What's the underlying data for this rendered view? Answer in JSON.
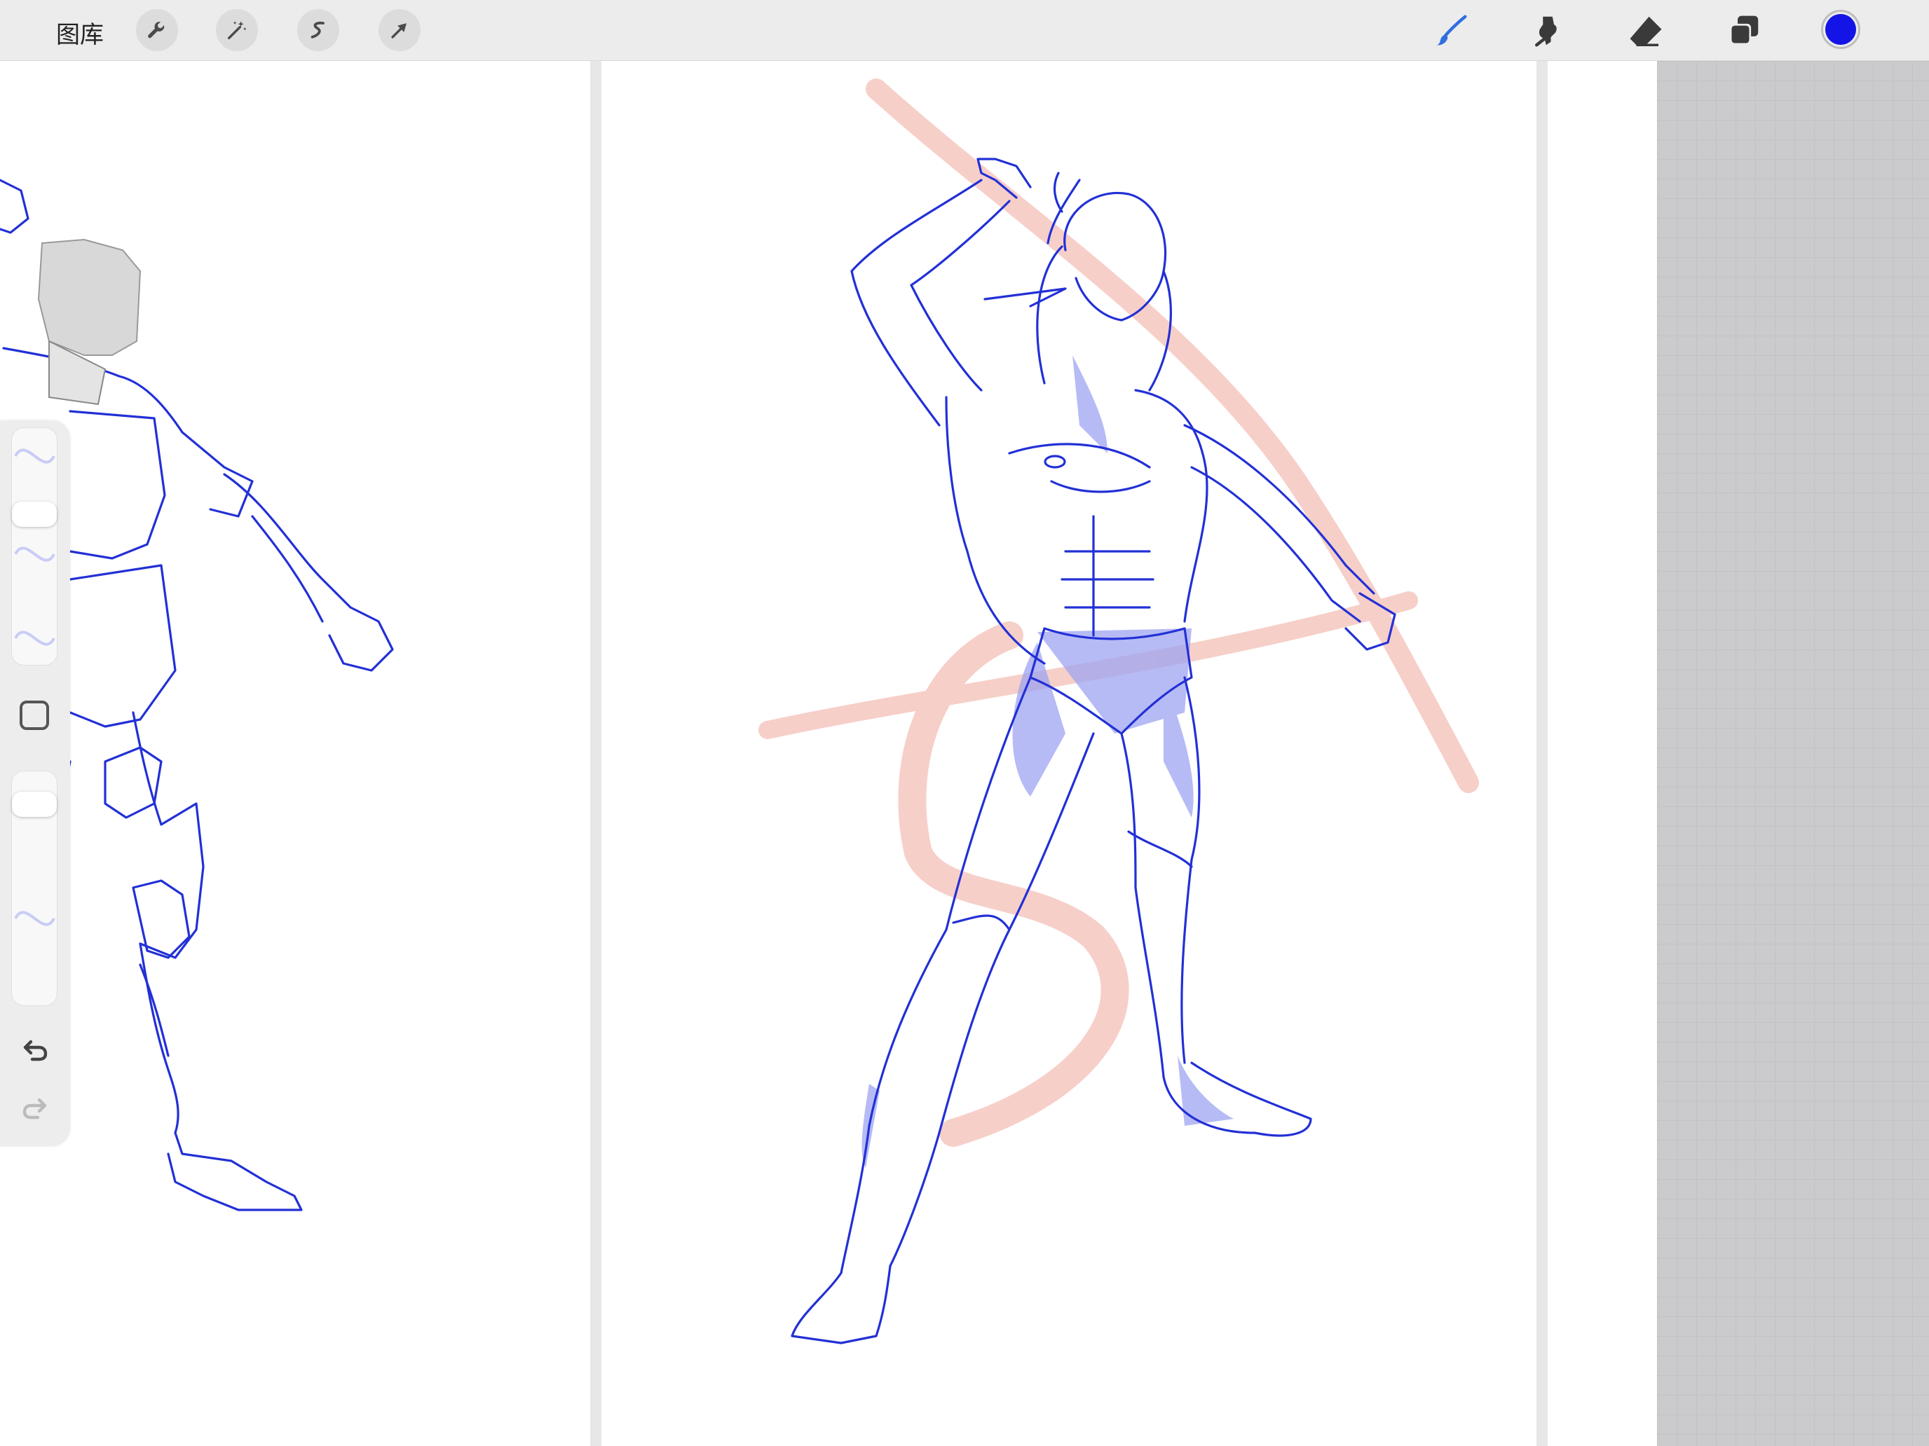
{
  "toolbar": {
    "gallery_label": "图库",
    "left_tools": [
      "wrench-icon",
      "magic-wand-icon",
      "selection-icon",
      "transform-arrow-icon"
    ],
    "right_tools": [
      "brush-icon",
      "smudge-icon",
      "eraser-icon",
      "layers-icon"
    ],
    "current_color": "#1414e6",
    "brush_color": "#2f6fe0"
  },
  "sidebar": {
    "brush_size_level": 0.65,
    "opacity_level": 0.9,
    "undo_icon": "undo-icon",
    "redo_icon": "redo-icon"
  },
  "canvas": {
    "sketch_color": "#2230d6",
    "rough_color": "#f0a89c",
    "shade_color": "#9ea4f2",
    "grid_background": "#cbcbcd"
  }
}
